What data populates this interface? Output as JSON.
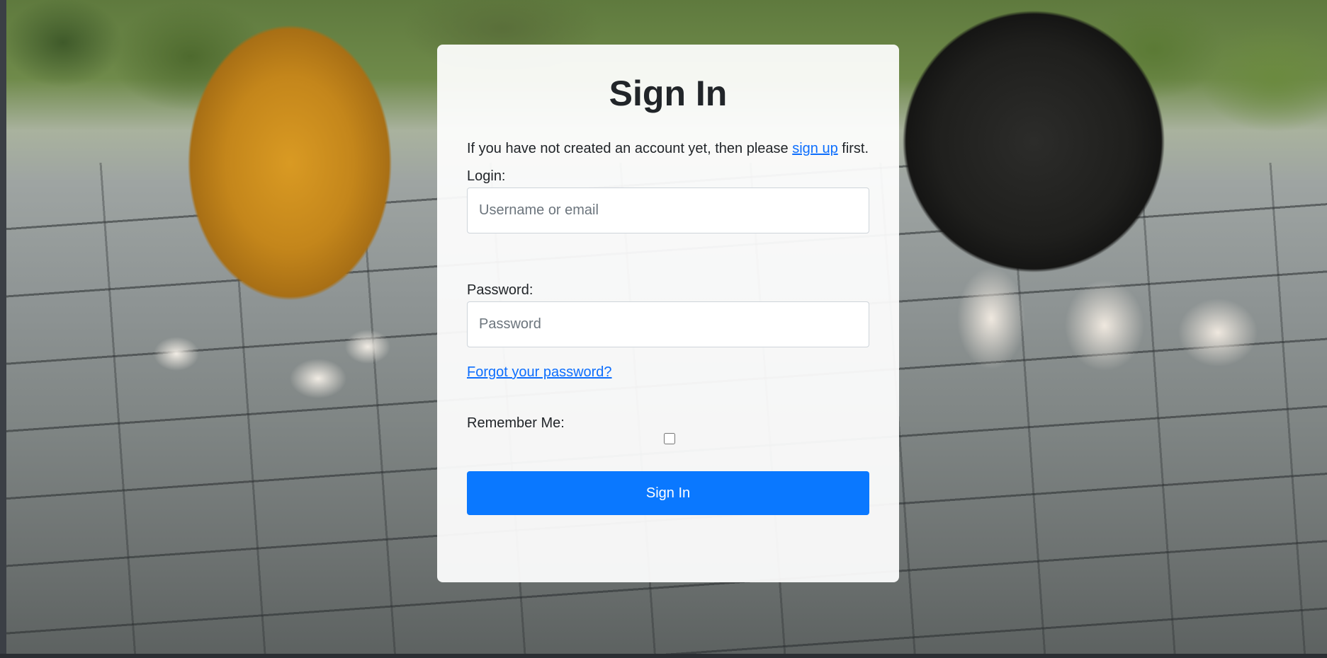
{
  "signin": {
    "title": "Sign In",
    "intro_prefix": "If you have not created an account yet, then please ",
    "signup_link": "sign up",
    "intro_suffix": " first.",
    "login_label": "Login:",
    "login_placeholder": "Username or email",
    "login_value": "",
    "password_label": "Password:",
    "password_placeholder": "Password",
    "password_value": "",
    "forgot_link": "Forgot your password?",
    "remember_label": "Remember Me:",
    "remember_checked": false,
    "submit_label": "Sign In"
  },
  "colors": {
    "accent": "#0a78ff",
    "link": "#0d6efd",
    "text": "#212529"
  }
}
